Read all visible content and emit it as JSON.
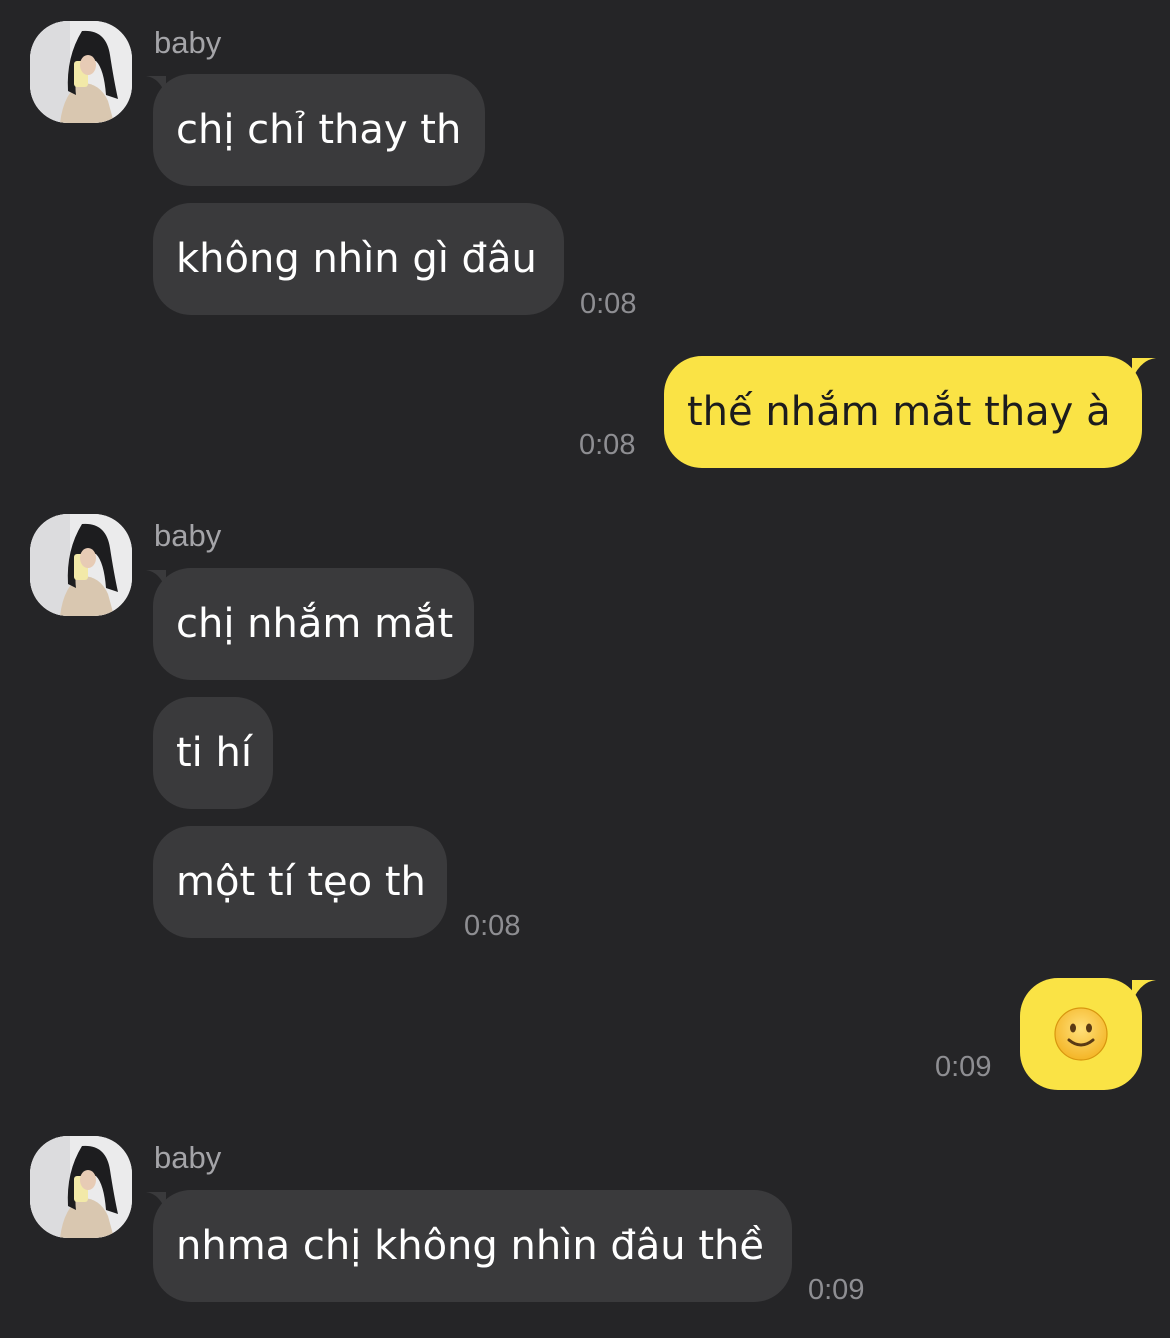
{
  "contact": {
    "name": "baby"
  },
  "groups": [
    {
      "sender": "baby",
      "messages": [
        "chị chỉ thay th",
        "không nhìn gì đâu"
      ],
      "time": "0:08"
    },
    {
      "sender": "me",
      "messages": [
        "thế nhắm mắt thay à"
      ],
      "time": "0:08"
    },
    {
      "sender": "baby",
      "messages": [
        "chị nhắm mắt",
        "ti hí",
        "một tí tẹo th"
      ],
      "time": "0:08"
    },
    {
      "sender": "me",
      "messages": [
        "slightly-smiling-face-emoji"
      ],
      "time": "0:09"
    },
    {
      "sender": "baby",
      "messages": [
        "nhma chị không nhìn đâu thề"
      ],
      "time": "0:09"
    }
  ],
  "colors": {
    "background": "#252527",
    "incoming_bubble": "#3a3a3c",
    "outgoing_bubble": "#fae345",
    "timestamp": "#8e8e92",
    "sender_name": "#a4a4a8"
  }
}
